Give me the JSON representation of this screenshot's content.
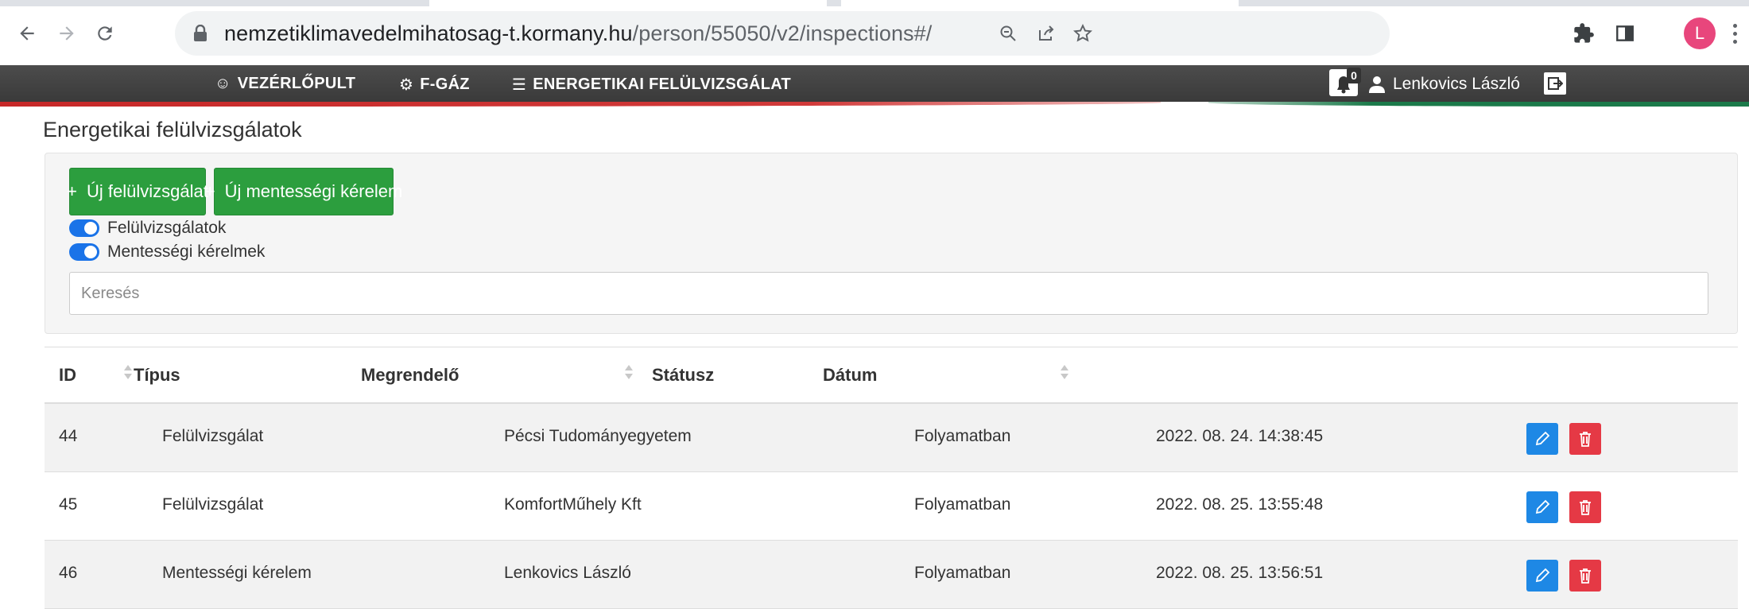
{
  "browser": {
    "url_host": "nemzetiklimavedelmihatosag-t.kormany.hu",
    "url_path": "/person/55050/v2/inspections#/",
    "profile_initial": "L",
    "icons": [
      "back-icon",
      "forward-icon",
      "reload-icon",
      "lock-icon",
      "zoom-icon",
      "share-icon",
      "star-icon",
      "extensions-icon",
      "sidepanel-icon",
      "menu-icon"
    ]
  },
  "navbar": {
    "items": [
      {
        "icon": "☺",
        "label": "VEZÉRLŐPULT"
      },
      {
        "icon": "⚙",
        "label": "F-GÁZ"
      },
      {
        "icon": "☰",
        "label": "ENERGETIKAI FELÜLVIZSGÁLAT"
      }
    ],
    "notification_count": "0",
    "user_name": "Lenkovics László"
  },
  "page": {
    "title": "Energetikai felülvizsgálatok"
  },
  "actions": {
    "new_inspection": "Új felülvizsgálat",
    "new_exemption": "Új mentességi kérelem",
    "plus": "+"
  },
  "filters": {
    "toggle_inspections": "Felülvizsgálatok",
    "toggle_exemptions": "Mentességi kérelmek",
    "search_placeholder": "Keresés"
  },
  "table": {
    "columns": [
      "ID",
      "Típus",
      "Megrendelő",
      "Státusz",
      "Dátum"
    ],
    "rows": [
      {
        "id": "44",
        "type": "Felülvizsgálat",
        "customer": "Pécsi Tudományegyetem",
        "status": "Folyamatban",
        "date": "2022. 08. 24. 14:38:45"
      },
      {
        "id": "45",
        "type": "Felülvizsgálat",
        "customer": "KomfortMűhely Kft",
        "status": "Folyamatban",
        "date": "2022. 08. 25. 13:55:48"
      },
      {
        "id": "46",
        "type": "Mentességi kérelem",
        "customer": "Lenkovics László",
        "status": "Folyamatban",
        "date": "2022. 08. 25. 13:56:51"
      }
    ]
  },
  "colors": {
    "navbar": "#3f3f3f",
    "green_button": "#2c9e3e",
    "edit_button": "#1e88e5",
    "delete_button": "#e53945",
    "toggle": "#1a73e8"
  }
}
